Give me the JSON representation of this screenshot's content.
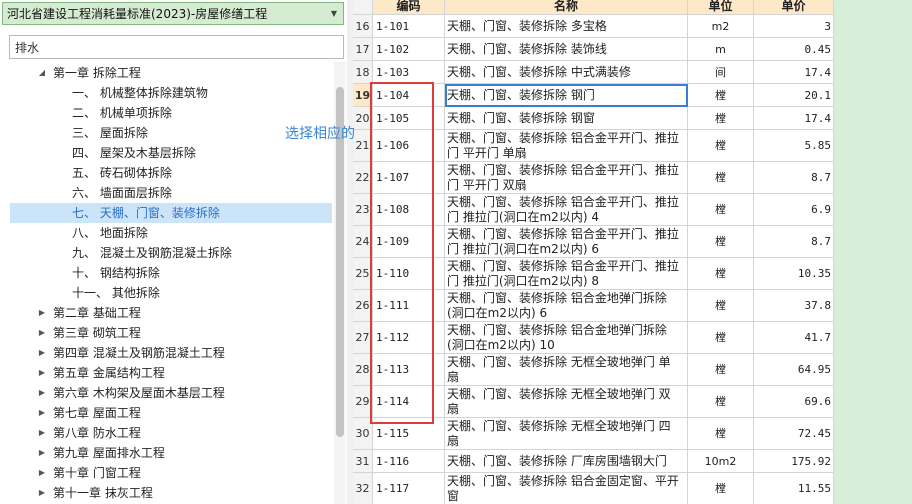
{
  "library": {
    "selected": "河北省建设工程消耗量标准(2023)-房屋修缮工程"
  },
  "search": {
    "value": "排水",
    "placeholder": ""
  },
  "tree": [
    {
      "level": 1,
      "expanded": true,
      "label": "第一章 拆除工程"
    },
    {
      "level": 2,
      "label": "一、 机械整体拆除建筑物"
    },
    {
      "level": 2,
      "label": "二、 机械单项拆除"
    },
    {
      "level": 2,
      "label": "三、 屋面拆除"
    },
    {
      "level": 2,
      "label": "四、 屋架及木基层拆除"
    },
    {
      "level": 2,
      "label": "五、 砖石砌体拆除"
    },
    {
      "level": 2,
      "label": "六、 墙面面层拆除"
    },
    {
      "level": 2,
      "label": "七、 天棚、门窗、装修拆除",
      "selected": true
    },
    {
      "level": 2,
      "label": "八、 地面拆除"
    },
    {
      "level": 2,
      "label": "九、 混凝土及钢筋混凝土拆除"
    },
    {
      "level": 2,
      "label": "十、 钢结构拆除"
    },
    {
      "level": 2,
      "label": "十一、 其他拆除"
    },
    {
      "level": 1,
      "expanded": false,
      "label": "第二章 基础工程"
    },
    {
      "level": 1,
      "expanded": false,
      "label": "第三章 砌筑工程"
    },
    {
      "level": 1,
      "expanded": false,
      "label": "第四章 混凝土及钢筋混凝土工程"
    },
    {
      "level": 1,
      "expanded": false,
      "label": "第五章 金属结构工程"
    },
    {
      "level": 1,
      "expanded": false,
      "label": "第六章 木构架及屋面木基层工程"
    },
    {
      "level": 1,
      "expanded": false,
      "label": "第七章 屋面工程"
    },
    {
      "level": 1,
      "expanded": false,
      "label": "第八章 防水工程"
    },
    {
      "level": 1,
      "expanded": false,
      "label": "第九章 屋面排水工程"
    },
    {
      "level": 1,
      "expanded": false,
      "label": "第十章 门窗工程"
    },
    {
      "level": 1,
      "expanded": false,
      "label": "第十一章 抹灰工程"
    }
  ],
  "annotation": "选择相应的",
  "grid": {
    "headers": {
      "idx": "",
      "code": "编码",
      "name": "名称",
      "unit": "单位",
      "price": "单价"
    },
    "rows": [
      {
        "idx": "16",
        "code": "1-101",
        "name": [
          "天棚、门窗、装修拆除 多宝格"
        ],
        "unit": "m2",
        "price": "3"
      },
      {
        "idx": "17",
        "code": "1-102",
        "name": [
          "天棚、门窗、装修拆除 装饰线"
        ],
        "unit": "m",
        "price": "0.45"
      },
      {
        "idx": "18",
        "code": "1-103",
        "name": [
          "天棚、门窗、装修拆除 中式满装修"
        ],
        "unit": "间",
        "price": "17.4"
      },
      {
        "idx": "19",
        "code": "1-104",
        "name": [
          "天棚、门窗、装修拆除 钢门"
        ],
        "unit": "樘",
        "price": "20.1",
        "selected": true
      },
      {
        "idx": "20",
        "code": "1-105",
        "name": [
          "天棚、门窗、装修拆除 钢窗"
        ],
        "unit": "樘",
        "price": "17.4"
      },
      {
        "idx": "21",
        "code": "1-106",
        "name": [
          "天棚、门窗、装修拆除 铝合金平开门、推拉",
          "门 平开门 单扇"
        ],
        "unit": "樘",
        "price": "5.85"
      },
      {
        "idx": "22",
        "code": "1-107",
        "name": [
          "天棚、门窗、装修拆除 铝合金平开门、推拉",
          "门 平开门 双扇"
        ],
        "unit": "樘",
        "price": "8.7"
      },
      {
        "idx": "23",
        "code": "1-108",
        "name": [
          "天棚、门窗、装修拆除 铝合金平开门、推拉",
          "门 推拉门(洞口在m2以内) 4"
        ],
        "unit": "樘",
        "price": "6.9"
      },
      {
        "idx": "24",
        "code": "1-109",
        "name": [
          "天棚、门窗、装修拆除 铝合金平开门、推拉",
          "门 推拉门(洞口在m2以内) 6"
        ],
        "unit": "樘",
        "price": "8.7"
      },
      {
        "idx": "25",
        "code": "1-110",
        "name": [
          "天棚、门窗、装修拆除 铝合金平开门、推拉",
          "门 推拉门(洞口在m2以内) 8"
        ],
        "unit": "樘",
        "price": "10.35"
      },
      {
        "idx": "26",
        "code": "1-111",
        "name": [
          "天棚、门窗、装修拆除 铝合金地弹门拆除",
          "(洞口在m2以内) 6"
        ],
        "unit": "樘",
        "price": "37.8"
      },
      {
        "idx": "27",
        "code": "1-112",
        "name": [
          "天棚、门窗、装修拆除 铝合金地弹门拆除",
          "(洞口在m2以内) 10"
        ],
        "unit": "樘",
        "price": "41.7"
      },
      {
        "idx": "28",
        "code": "1-113",
        "name": [
          "天棚、门窗、装修拆除 无框全玻地弹门 单",
          "扇"
        ],
        "unit": "樘",
        "price": "64.95"
      },
      {
        "idx": "29",
        "code": "1-114",
        "name": [
          "天棚、门窗、装修拆除 无框全玻地弹门 双",
          "扇"
        ],
        "unit": "樘",
        "price": "69.6"
      },
      {
        "idx": "30",
        "code": "1-115",
        "name": [
          "天棚、门窗、装修拆除 无框全玻地弹门 四",
          "扇"
        ],
        "unit": "樘",
        "price": "72.45"
      },
      {
        "idx": "31",
        "code": "1-116",
        "name": [
          "天棚、门窗、装修拆除 厂库房围墙钢大门"
        ],
        "unit": "10m2",
        "price": "175.92"
      },
      {
        "idx": "32",
        "code": "1-117",
        "name": [
          "天棚、门窗、装修拆除 铝合金固定窗、平开",
          "窗"
        ],
        "unit": "樘",
        "price": "11.55"
      }
    ]
  },
  "colors": {
    "selected_row_header": "#fde9c8",
    "tree_selected": "#cce4f7",
    "highlight_box": "#e03b3b",
    "cell_focus": "#3c7bd6"
  }
}
